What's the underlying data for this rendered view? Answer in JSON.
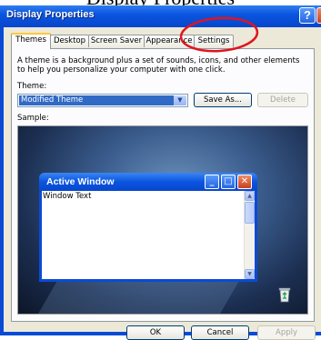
{
  "caption": "Display Properties",
  "window": {
    "title": "Display Properties",
    "help_label": "?",
    "close_label": "X"
  },
  "tabs": [
    {
      "label": "Themes",
      "active": true
    },
    {
      "label": "Desktop",
      "active": false
    },
    {
      "label": "Screen Saver",
      "active": false
    },
    {
      "label": "Appearance",
      "active": false
    },
    {
      "label": "Settings",
      "active": false
    }
  ],
  "themes_panel": {
    "description": "A theme is a background plus a set of sounds, icons, and other elements to help you personalize your computer with one click.",
    "theme_label": "Theme:",
    "theme_value": "Modified Theme",
    "save_as_label": "Save As...",
    "delete_label": "Delete",
    "sample_label": "Sample:"
  },
  "sample": {
    "active_window_title": "Active Window",
    "window_text": "Window Text"
  },
  "footer": {
    "ok_label": "OK",
    "cancel_label": "Cancel",
    "apply_label": "Apply"
  },
  "colors": {
    "title_blue": "#0a55e0",
    "dialog_bg": "#ece9d8",
    "selection": "#316ac5",
    "annotation_red": "#e0141e"
  },
  "icons": [
    "help-icon",
    "close-icon",
    "chevron-down-icon",
    "minimize-icon",
    "maximize-icon",
    "recycle-bin-icon"
  ]
}
